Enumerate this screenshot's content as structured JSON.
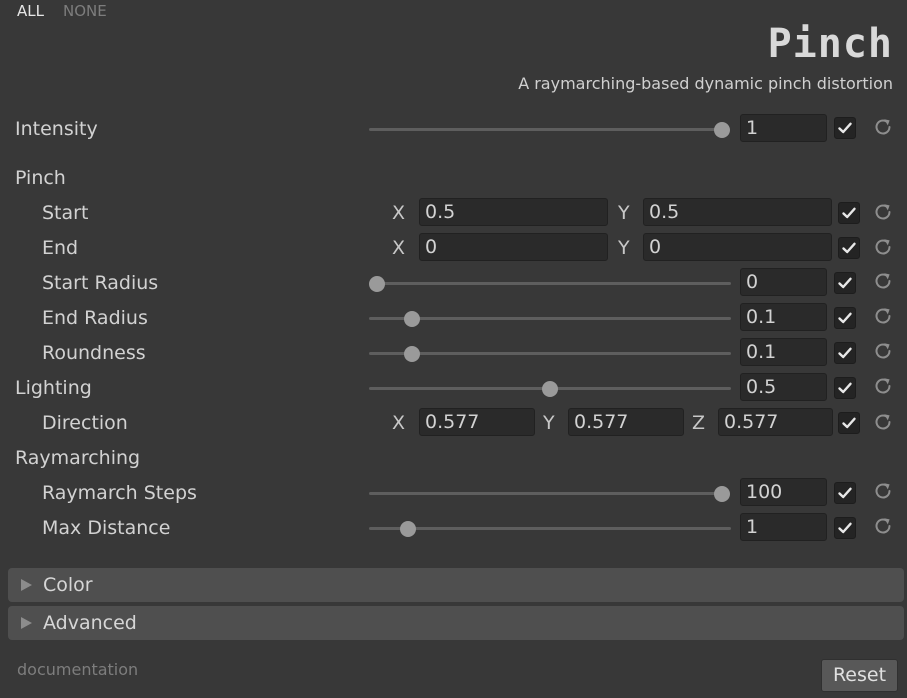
{
  "toggles": {
    "all": "ALL",
    "none": "NONE"
  },
  "header": {
    "title": "Pinch",
    "subtitle": "A raymarching-based dynamic pinch distortion"
  },
  "params": {
    "intensity": {
      "label": "Intensity",
      "value": "1",
      "slider": 1.0,
      "enabled": true
    },
    "pinch": {
      "label": "Pinch",
      "start": {
        "label": "Start",
        "x_axis": "X",
        "x": "0.5",
        "y_axis": "Y",
        "y": "0.5",
        "enabled": true
      },
      "end": {
        "label": "End",
        "x_axis": "X",
        "x": "0",
        "y_axis": "Y",
        "y": "0",
        "enabled": true
      },
      "start_radius": {
        "label": "Start Radius",
        "value": "0",
        "slider": 0.0,
        "enabled": true
      },
      "end_radius": {
        "label": "End Radius",
        "value": "0.1",
        "slider": 0.1,
        "enabled": true
      },
      "roundness": {
        "label": "Roundness",
        "value": "0.1",
        "slider": 0.1,
        "enabled": true
      }
    },
    "lighting": {
      "label": "Lighting",
      "value": "0.5",
      "slider": 0.5,
      "enabled": true,
      "direction": {
        "label": "Direction",
        "x_axis": "X",
        "x": "0.577",
        "y_axis": "Y",
        "y": "0.577",
        "z_axis": "Z",
        "z": "0.577",
        "enabled": true
      }
    },
    "raymarching": {
      "label": "Raymarching",
      "steps": {
        "label": "Raymarch Steps",
        "value": "100",
        "slider": 1.0,
        "enabled": true
      },
      "max_distance": {
        "label": "Max Distance",
        "value": "1",
        "slider": 0.11,
        "enabled": true
      }
    }
  },
  "foldouts": {
    "color": "Color",
    "advanced": "Advanced"
  },
  "footer": {
    "documentation": "documentation",
    "reset": "Reset"
  },
  "icons": {
    "check": "check-icon",
    "reset": "reset-icon",
    "foldout": "triangle-right-icon"
  }
}
